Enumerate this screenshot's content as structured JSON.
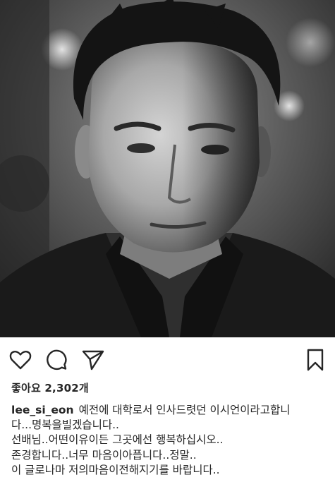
{
  "post": {
    "photo": {
      "alt_icon": "portrait-photo",
      "tones": {
        "dark": "#1c1c1c",
        "mid": "#6b6b6b",
        "light": "#d9d9d9"
      }
    },
    "actions": {
      "like_icon": "heart-icon",
      "comment_icon": "comment-bubble-icon",
      "share_icon": "paper-plane-icon",
      "save_icon": "bookmark-icon"
    },
    "likes_text": "좋아요 2,302개",
    "caption": {
      "username": "lee_si_eon",
      "first_line": "예전에 대학로서 인사드렷던 이시언이라고합니",
      "lines": [
        "다...명복을빌겠습니다..",
        "선배님..어떤이유이든 그곳에선 행복하십시오..",
        "존경합니다..너무 마음이아픕니다..정말..",
        "이 글로나마 저의마음이전해지기를 바랍니다.."
      ]
    }
  }
}
